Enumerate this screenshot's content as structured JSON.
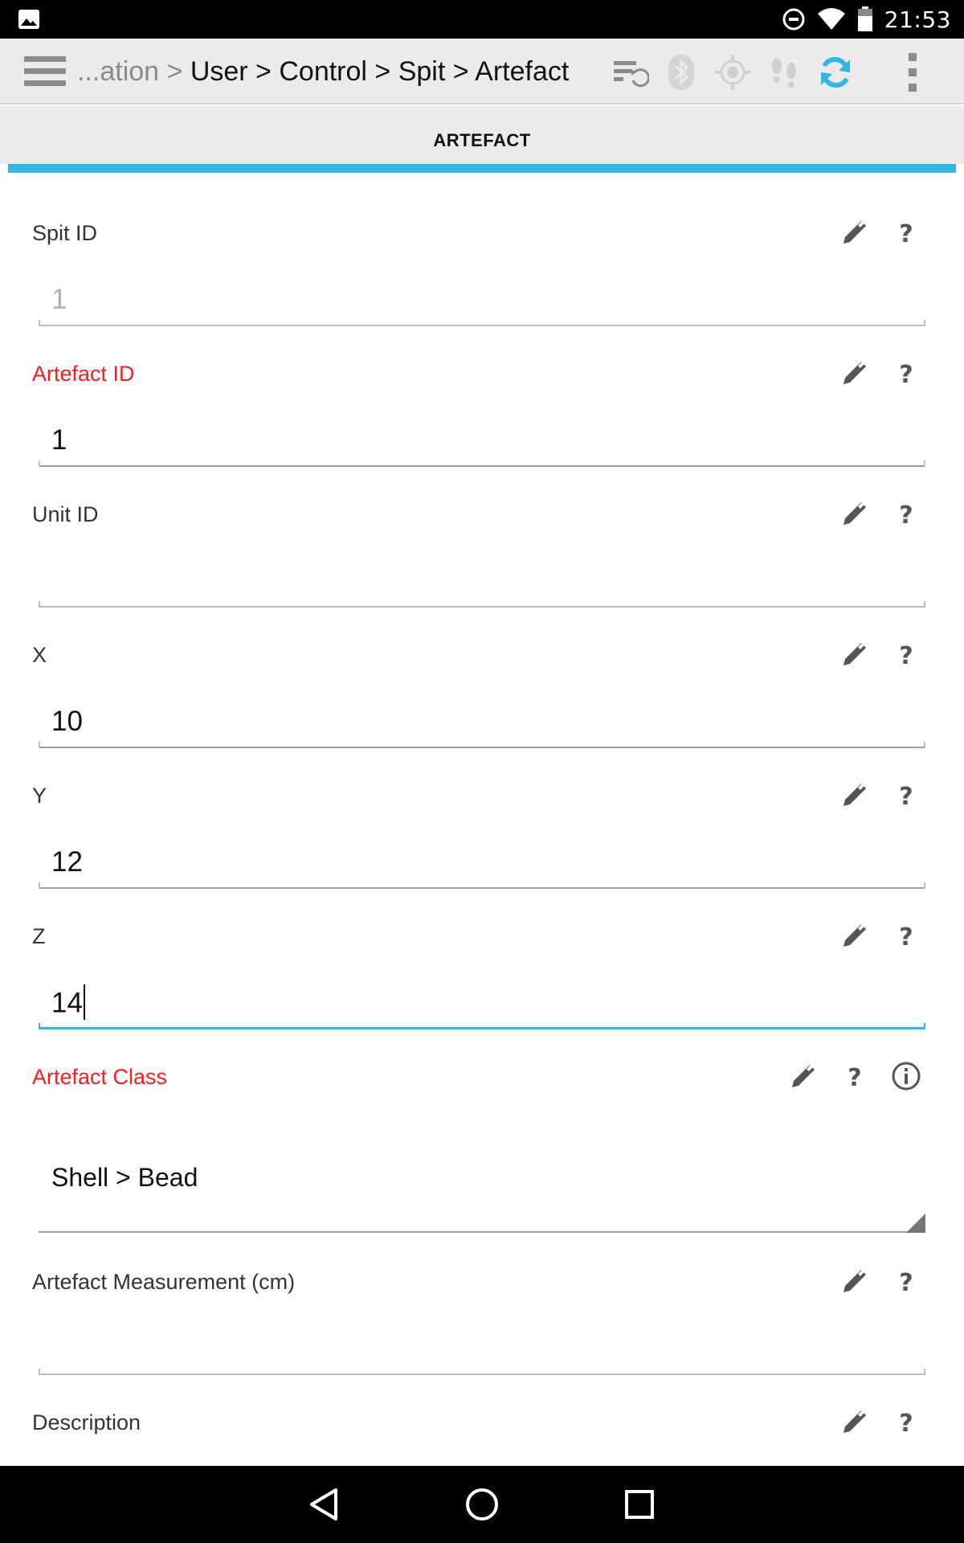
{
  "status_bar": {
    "time": "21:53",
    "icons": [
      "image-notification-icon",
      "do-not-disturb-icon",
      "wifi-icon",
      "battery-icon"
    ]
  },
  "action_bar": {
    "breadcrumb_prefix": "...ation > ",
    "breadcrumb_path": "User > Control > Spit > Artefact",
    "icons": [
      "menu-icon",
      "sync-status-icon",
      "bluetooth-icon",
      "gps-icon",
      "tracking-icon",
      "sync-icon",
      "overflow-menu-icon"
    ],
    "accent_color": "#33b5e5"
  },
  "tab": {
    "label": "ARTEFACT"
  },
  "fields": [
    {
      "label": "Spit ID",
      "value": "1",
      "required": false,
      "disabled": true
    },
    {
      "label": "Artefact ID",
      "value": "1",
      "required": true
    },
    {
      "label": "Unit ID",
      "value": "",
      "required": false
    },
    {
      "label": "X",
      "value": "10",
      "required": false
    },
    {
      "label": "Y",
      "value": "12",
      "required": false
    },
    {
      "label": "Z",
      "value": "14",
      "required": false,
      "focused": true
    },
    {
      "label": "Artefact Class",
      "value": "Shell > Bead",
      "required": true,
      "type": "select"
    },
    {
      "label": "Artefact Measurement (cm)",
      "value": "",
      "required": false
    },
    {
      "label": "Description",
      "value": "",
      "required": false
    }
  ],
  "icons": {
    "edit": "pencil-icon",
    "help": "question-icon",
    "info": "info-icon"
  },
  "nav_bar": {
    "icons": [
      "back-icon",
      "home-icon",
      "recents-icon"
    ]
  }
}
